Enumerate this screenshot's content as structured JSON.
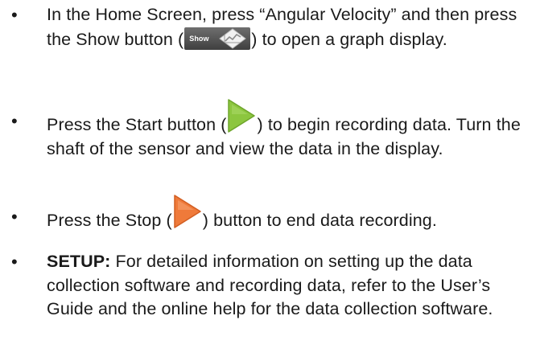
{
  "colors": {
    "start_button": "#8cc63f",
    "stop_button": "#ef7a3a",
    "show_button_bg": "#555555"
  },
  "icons": {
    "show": "graph-icon",
    "start": "play-triangle-green",
    "stop": "play-triangle-orange"
  },
  "show_button_label": "Show",
  "steps": [
    {
      "bullet": "•",
      "text_a": "In the Home Screen, press  “Angular Velocity” and then press the Show button (",
      "text_b": ") to open a graph display."
    },
    {
      "bullet": "•",
      "text_a": "Press the Start button (",
      "text_b": ") to begin recording data. Turn the shaft of the sensor and view the data in the display."
    },
    {
      "bullet": "•",
      "text_a": "Press the Stop (",
      "text_b": ") button to end data recording."
    },
    {
      "bullet": "•",
      "bold": "SETUP:",
      "text_b": " For detailed information on setting up the data collection software and recording data, refer to the User’s Guide and the online help for the data collection software."
    }
  ]
}
